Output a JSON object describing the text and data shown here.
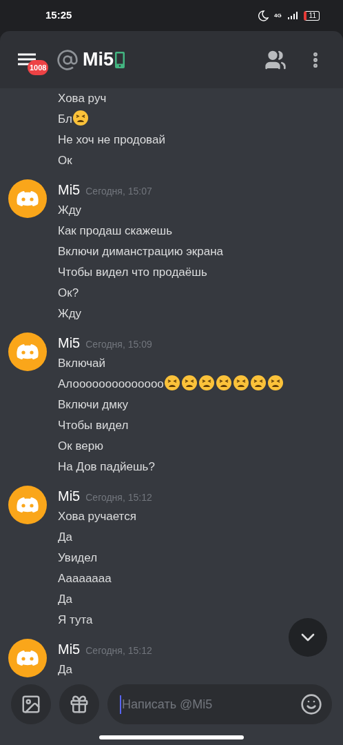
{
  "status_bar": {
    "time": "15:25",
    "network": "4G",
    "battery": "11"
  },
  "header": {
    "menu_badge": "1008",
    "channel": "Mi5",
    "mobile": true
  },
  "groups": [
    {
      "lines": [
        {
          "text": "Хова руч"
        },
        {
          "text": "Бл",
          "emoji": [
            {
              "kind": "weary"
            }
          ]
        },
        {
          "text": "Не хоч не продовай"
        },
        {
          "text": "Ок"
        }
      ]
    },
    {
      "author": "Mi5",
      "time": "Сегодня, 15:07",
      "lines": [
        {
          "text": "Жду"
        },
        {
          "text": "Как продаш скажешь"
        },
        {
          "text": "Включи диманстрацию экрана"
        },
        {
          "text": "Чтобы видел что продаёшь"
        },
        {
          "text": "Ок?"
        },
        {
          "text": "Жду"
        }
      ]
    },
    {
      "author": "Mi5",
      "time": "Сегодня, 15:09",
      "lines": [
        {
          "text": "Включай"
        },
        {
          "text": "Алоооооооооооооо",
          "emoji": [
            {
              "kind": "weary"
            },
            {
              "kind": "weary"
            },
            {
              "kind": "weary"
            },
            {
              "kind": "weary"
            },
            {
              "kind": "weary"
            },
            {
              "kind": "weary"
            },
            {
              "kind": "weary"
            }
          ]
        },
        {
          "text": "Включи дмку"
        },
        {
          "text": "Чтобы видел"
        },
        {
          "text": "Ок верю"
        },
        {
          "text": "На Дов падйешь?"
        }
      ]
    },
    {
      "author": "Mi5",
      "time": "Сегодня, 15:12",
      "lines": [
        {
          "text": "Хова ручается"
        },
        {
          "text": "Да"
        },
        {
          "text": "Увидел"
        },
        {
          "text": "Ааааaааа"
        },
        {
          "text": "Да"
        },
        {
          "text": "Я тута"
        }
      ]
    },
    {
      "author": "Mi5",
      "time": "Сегодня, 15:12",
      "lines": [
        {
          "text": "Да"
        }
      ]
    }
  ],
  "composer": {
    "placeholder": "Написать @Mi5"
  }
}
